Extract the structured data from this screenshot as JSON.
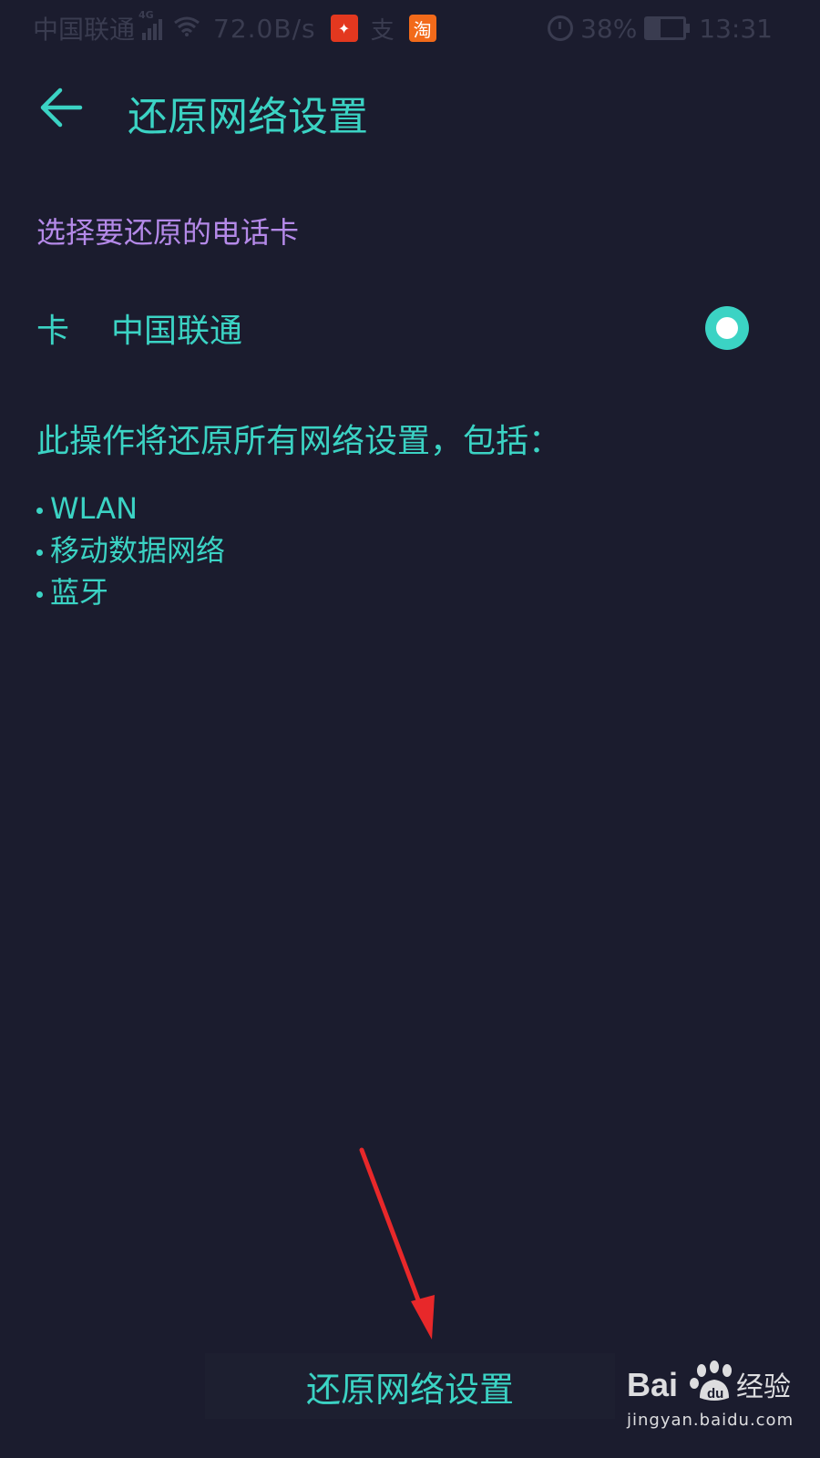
{
  "status_bar": {
    "carrier": "中国联通",
    "network_type": "4G",
    "speed": "72.0B/s",
    "app_icons": [
      {
        "name": "news-app-icon",
        "glyph": "✦",
        "color": "#e3381f"
      },
      {
        "name": "taobao-app-icon",
        "glyph": "淘",
        "color": "#f26a1a"
      }
    ],
    "mid_glyph": "支",
    "battery_percent": "38%",
    "battery_level": 0.38,
    "time": "13:31"
  },
  "header": {
    "title": "还原网络设置"
  },
  "sim_section": {
    "label": "选择要还原的电话卡",
    "card_prefix": "卡",
    "card_name": "中国联通",
    "selected": true
  },
  "description": "此操作将还原所有网络设置，包括：",
  "reset_items": [
    "WLAN",
    "移动数据网络",
    "蓝牙"
  ],
  "action_button": {
    "label": "还原网络设置"
  },
  "watermark": {
    "logo_text": "Bai经验",
    "url": "jingyan.baidu.com"
  },
  "colors": {
    "background": "#1b1c2e",
    "accent": "#3bd3c4",
    "section_label": "#b489e8",
    "annotation_arrow": "#e8282a"
  }
}
